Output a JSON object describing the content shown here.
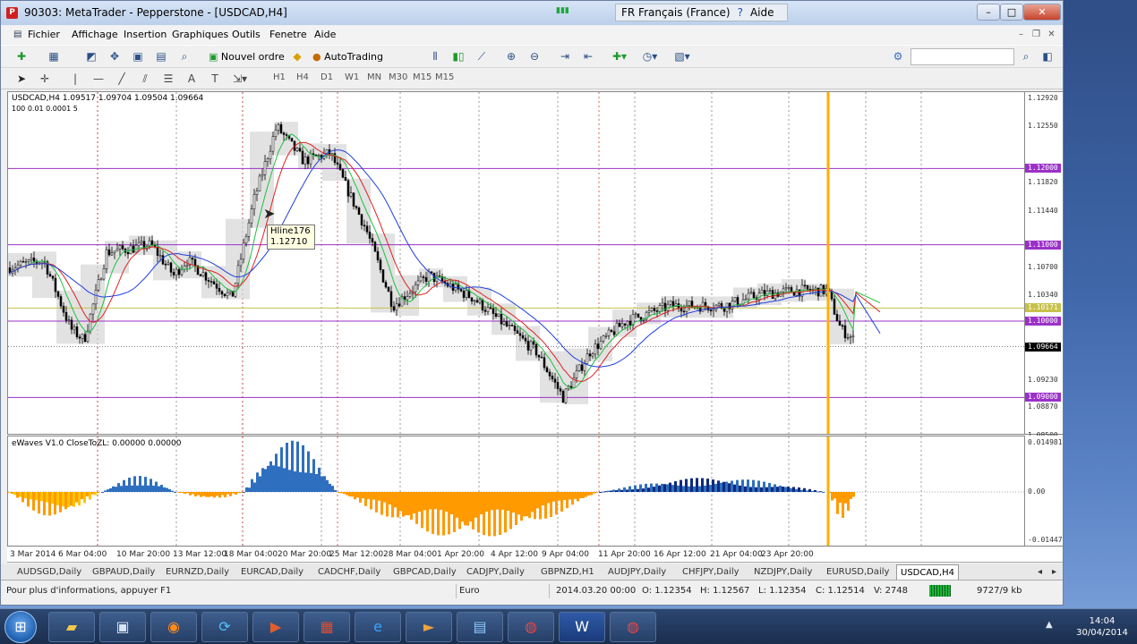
{
  "window": {
    "title": "90303: MetaTrader - Pepperstone - [USDCAD,H4]",
    "logo": "P",
    "lang": "FR Français (France)",
    "help": "Aide"
  },
  "menu": [
    "Fichier",
    "Affichage",
    "Insertion",
    "Graphiques",
    "Outils",
    "Fenetre",
    "Aide"
  ],
  "toolbar": {
    "new_order": "Nouvel ordre",
    "autotrading": "AutoTrading"
  },
  "timeframes": [
    "H1",
    "H4",
    "D1",
    "W1",
    "MN",
    "M30",
    "M15"
  ],
  "chart": {
    "header": "USDCAD,H4  1.09517 1.09704 1.09504 1.09664",
    "subheader": "100 0.01 0.0001 5",
    "tooltip_name": "Hline176",
    "tooltip_value": "1.12710",
    "price_labels": [
      "1.12920",
      "1.12550",
      "1.11820",
      "1.11440",
      "1.10700",
      "1.10340",
      "1.09230",
      "1.08870",
      "1.08500"
    ],
    "hlines": [
      {
        "label": "1.12000",
        "price": 1.12,
        "color": "#9b31c8"
      },
      {
        "label": "1.11000",
        "price": 1.11,
        "color": "#9b31c8"
      },
      {
        "label": "1.10171",
        "price": 1.10171,
        "color": "#c7c24a"
      },
      {
        "label": "1.10000",
        "price": 1.1,
        "color": "#9b31c8"
      },
      {
        "label": "1.09664",
        "price": 1.09664,
        "color": "#000000"
      },
      {
        "label": "1.09000",
        "price": 1.09,
        "color": "#9b31c8"
      }
    ],
    "ylim": [
      1.085,
      1.13
    ]
  },
  "indicator": {
    "header": "eWaves V1.0 CloseToZL: 0.00000 0.00000",
    "labels": [
      "0.014981",
      "0.00",
      "-0.01447"
    ]
  },
  "time_labels": [
    "3 Mar 2014",
    "6 Mar 04:00",
    "10 Mar 20:00",
    "13 Mar 12:00",
    "18 Mar 04:00",
    "20 Mar 20:00",
    "25 Mar 12:00",
    "28 Mar 04:00",
    "1 Apr 20:00",
    "4 Apr 12:00",
    "9 Apr 04:00",
    "11 Apr 20:00",
    "16 Apr 12:00",
    "21 Apr 04:00",
    "23 Apr 20:00"
  ],
  "tabs": [
    "AUDSGD,Daily",
    "GBPAUD,Daily",
    "EURNZD,Daily",
    "EURCAD,Daily",
    "CADCHF,Daily",
    "GBPCAD,Daily",
    "CADJPY,Daily",
    "GBPNZD,H1",
    "AUDJPY,Daily",
    "CHFJPY,Daily",
    "NZDJPY,Daily",
    "EURUSD,Daily",
    "USDCAD,H4"
  ],
  "status": {
    "help": "Pour plus d'informations, appuyer F1",
    "profile": "Euro",
    "datetime": "2014.03.20 00:00",
    "open": "O: 1.12354",
    "high": "H: 1.12567",
    "low": "L: 1.12354",
    "close": "C: 1.12514",
    "volume": "V: 2748",
    "traffic": "9727/9 kb"
  },
  "clock": {
    "time": "14:04",
    "date": "30/04/2014"
  },
  "colors": {
    "ma_red": "#e02020",
    "ma_green": "#20c040",
    "ma_blue": "#2040e0",
    "cursor_line": "#ffb000",
    "buy_bar": "#0d2a80",
    "sell_bar": "#ffc400"
  }
}
